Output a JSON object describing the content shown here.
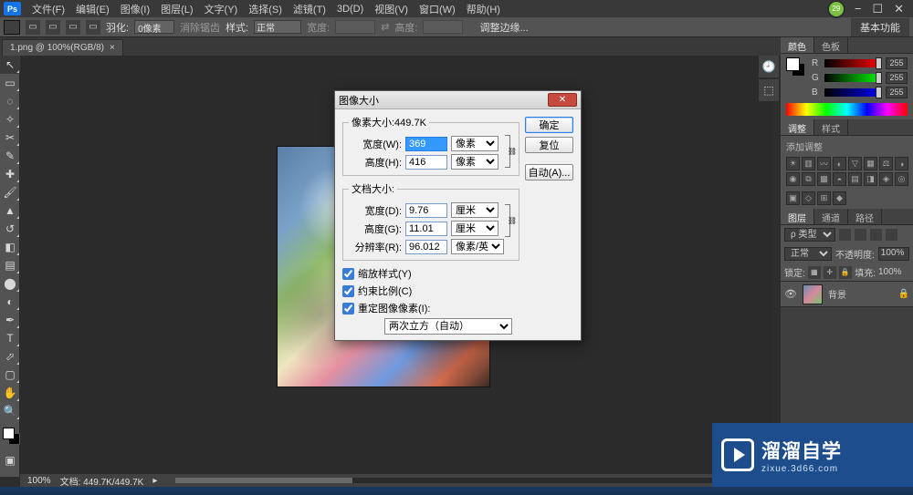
{
  "app": {
    "menus": [
      "文件(F)",
      "编辑(E)",
      "图像(I)",
      "图层(L)",
      "文字(Y)",
      "选择(S)",
      "滤镜(T)",
      "3D(D)",
      "视图(V)",
      "窗口(W)",
      "帮助(H)"
    ],
    "workspace_label": "基本功能",
    "update_count": "29"
  },
  "options": {
    "feather_label": "羽化:",
    "feather_value": "0像素",
    "antialias_label": "消除锯齿",
    "style_label": "样式:",
    "style_value": "正常",
    "width_label": "宽度:",
    "height_label": "高度:",
    "refine_label": "调整边缘..."
  },
  "document": {
    "tab_label": "1.png @ 100%(RGB/8)"
  },
  "status": {
    "zoom": "100%",
    "info": "文档: 449.7K/449.7K"
  },
  "panels": {
    "color": {
      "tab1": "颜色",
      "tab2": "色板",
      "r": "255",
      "g": "255",
      "b": "255"
    },
    "adjust": {
      "tab1": "调整",
      "tab2": "样式",
      "hint": "添加调整"
    },
    "layers": {
      "tab1": "图层",
      "tab2": "通道",
      "tab3": "路径",
      "kind": "正常",
      "opacity_lbl": "不透明度:",
      "opacity_val": "100%",
      "lock_lbl": "锁定:",
      "fill_lbl": "填充:",
      "fill_val": "100%",
      "layer0_name": "背景"
    }
  },
  "watermark": {
    "main": "溜溜自学",
    "sub": "zixue.3d66.com"
  },
  "dialog": {
    "title": "图像大小",
    "pixel_dim_legend": "像素大小:449.7K",
    "width_label": "宽度(W):",
    "width_value": "369",
    "width_unit": "像素",
    "height_label": "高度(H):",
    "height_value": "416",
    "height_unit": "像素",
    "doc_size_legend": "文档大小:",
    "doc_width_label": "宽度(D):",
    "doc_width_value": "9.76",
    "doc_width_unit": "厘米",
    "doc_height_label": "高度(G):",
    "doc_height_value": "11.01",
    "doc_height_unit": "厘米",
    "res_label": "分辨率(R):",
    "res_value": "96.012",
    "res_unit": "像素/英寸",
    "scale_styles": "缩放样式(Y)",
    "constrain": "约束比例(C)",
    "resample": "重定图像像素(I):",
    "resample_method": "两次立方（自动）",
    "ok": "确定",
    "cancel": "复位",
    "auto": "自动(A)..."
  }
}
